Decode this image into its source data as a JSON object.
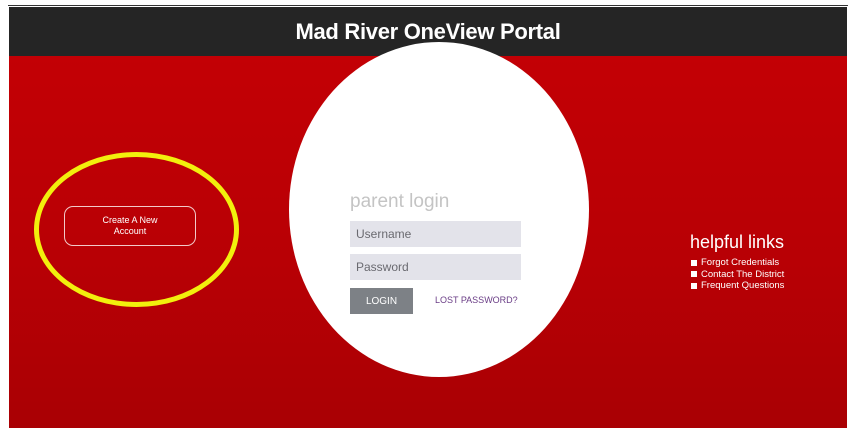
{
  "header": {
    "title": "Mad River OneView Portal"
  },
  "signup": {
    "create_account_label": "Create A New Account"
  },
  "login": {
    "title": "parent login",
    "username_placeholder": "Username",
    "password_placeholder": "Password",
    "login_label": "LOGIN",
    "lost_password_label": "LOST PASSWORD?"
  },
  "helpful_links": {
    "title": "helpful links",
    "items": [
      {
        "label": "Forgot Credentials"
      },
      {
        "label": "Contact The District"
      },
      {
        "label": "Frequent Questions"
      }
    ]
  },
  "colors": {
    "header_bg": "#252525",
    "hero_red": "#c30005",
    "highlight_yellow": "#f2ef0d",
    "login_button": "#7d8186",
    "lost_password_link": "#6a3d86"
  },
  "icons": [
    "bullet-icon"
  ]
}
